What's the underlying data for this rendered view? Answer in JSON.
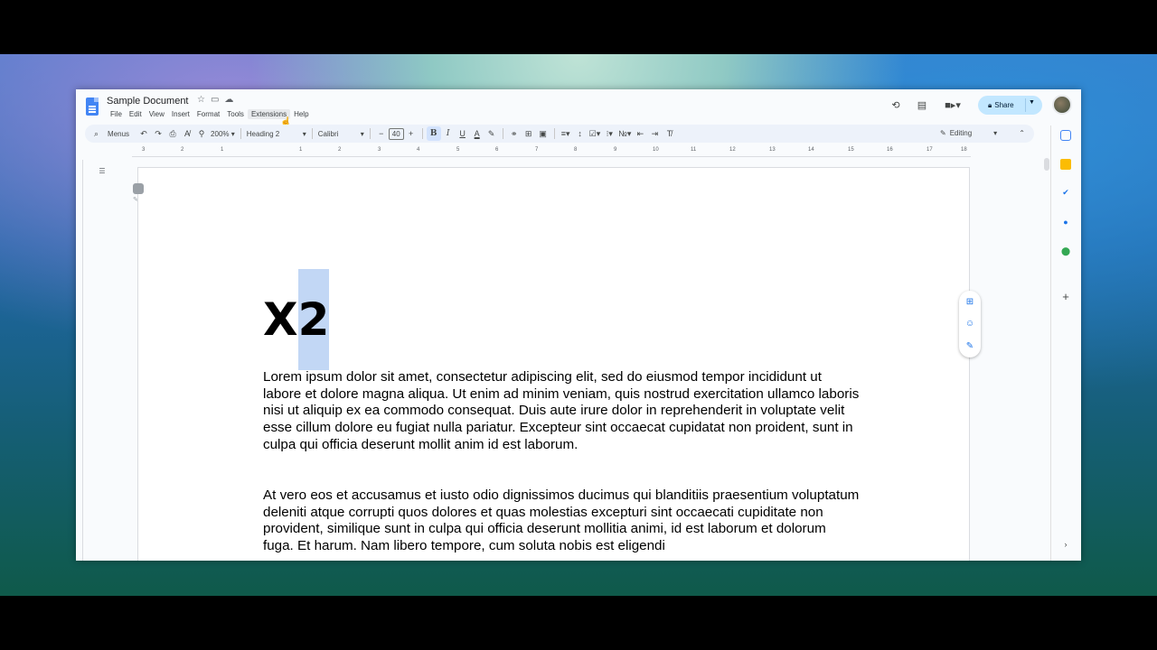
{
  "document": {
    "title": "Sample Document",
    "menus": [
      "File",
      "Edit",
      "View",
      "Insert",
      "Format",
      "Tools",
      "Extensions",
      "Help"
    ]
  },
  "header": {
    "share_label": "Share"
  },
  "toolbar": {
    "search_menus": "Menus",
    "zoom": "200%",
    "style": "Heading 2",
    "font": "Calibri",
    "font_size": "40",
    "mode": "Editing"
  },
  "ruler": {
    "ticks": [
      "3",
      "2",
      "1",
      "1",
      "2",
      "3",
      "4",
      "5",
      "6",
      "7",
      "8",
      "9",
      "10",
      "11",
      "12",
      "13",
      "14",
      "15",
      "16",
      "17",
      "18"
    ]
  },
  "content": {
    "heading_plain": "X",
    "heading_selected": "2",
    "paragraph1": "Lorem ipsum dolor sit amet, consectetur adipiscing elit, sed do eiusmod tempor incididunt ut labore et dolore magna aliqua. Ut enim ad minim veniam, quis nostrud exercitation ullamco laboris nisi ut aliquip ex ea commodo consequat. Duis aute irure dolor in reprehenderit in voluptate velit esse cillum dolore eu fugiat nulla pariatur. Excepteur sint occaecat cupidatat non proident, sunt in culpa qui officia deserunt mollit anim id est laborum.",
    "paragraph2": "At vero eos et accusamus et iusto odio dignissimos ducimus qui blanditiis praesentium voluptatum deleniti atque corrupti quos dolores et quas molestias excepturi sint occaecati cupiditate non provident, similique sunt in culpa qui officia deserunt mollitia animi, id est laborum et dolorum fuga. Et harum. Nam libero tempore, cum soluta nobis est eligendi"
  },
  "colors": {
    "accent": "#1a73e8",
    "share_bg": "#c2e7ff",
    "selection": "#c2d7f5",
    "toolbar_bg": "#edf2fa"
  }
}
